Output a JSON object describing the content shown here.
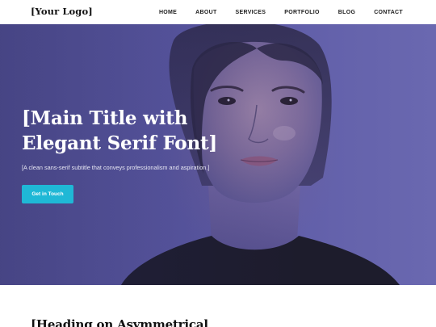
{
  "header": {
    "logo": "[Your Logo]",
    "nav": [
      "HOME",
      "ABOUT",
      "SERVICES",
      "PORTFOLIO",
      "BLOG",
      "CONTACT"
    ]
  },
  "hero": {
    "title_line1": "[Main Title with",
    "title_line2": "Elegant Serif Font]",
    "subtitle": "[A clean sans-serif subtitle that conveys professionalism and aspiration.]",
    "cta_label": "Get in Touch",
    "accent_color": "#1fb8d6",
    "overlay_color": "#5a58a2"
  },
  "section": {
    "heading": "[Heading on Asymmetrical"
  }
}
